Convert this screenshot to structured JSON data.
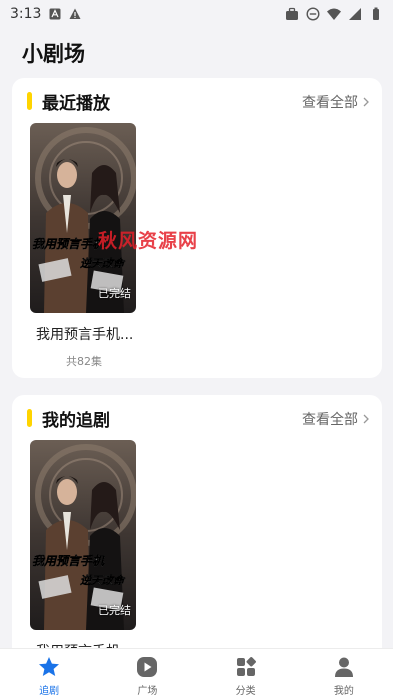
{
  "status_bar": {
    "time": "3:13"
  },
  "header": {
    "title": "小剧场"
  },
  "sections": {
    "recent": {
      "title": "最近播放",
      "view_all": "查看全部",
      "item": {
        "title": "我用预言手机...",
        "episodes": "共82集",
        "badge": "已完结",
        "poster_line1": "我用预言手机",
        "poster_line2": "逆天改命"
      }
    },
    "follow": {
      "title": "我的追剧",
      "view_all": "查看全部",
      "item": {
        "title": "我用预言手机",
        "badge": "已完结",
        "poster_line1": "我用预言手机",
        "poster_line2": "逆天改命"
      }
    }
  },
  "watermark": "秋风资源网",
  "tabs": [
    {
      "label": "追剧",
      "icon": "star-icon",
      "active": true
    },
    {
      "label": "广场",
      "icon": "play-circle-icon",
      "active": false
    },
    {
      "label": "分类",
      "icon": "category-grid-icon",
      "active": false
    },
    {
      "label": "我的",
      "icon": "profile-icon",
      "active": false
    }
  ],
  "colors": {
    "accent_yellow": "#ffd400",
    "tab_active": "#1a73e8"
  }
}
